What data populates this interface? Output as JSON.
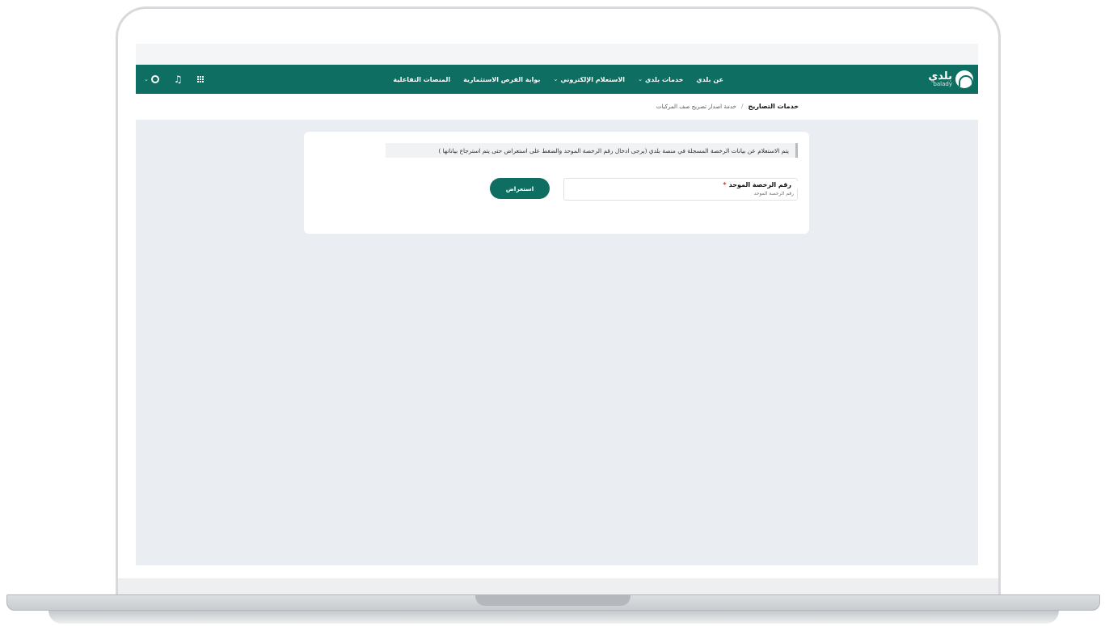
{
  "brand": {
    "name_ar": "بلدي",
    "name_en": "balady"
  },
  "nav": {
    "links": [
      {
        "label": "عن بلدي",
        "has_dropdown": false
      },
      {
        "label": "خدمات بلدي",
        "has_dropdown": true
      },
      {
        "label": "الاستعلام الإلكتروني",
        "has_dropdown": true
      },
      {
        "label": "بوابة الفرص الاستثمارية",
        "has_dropdown": false
      },
      {
        "label": "المنصات التفاعلية",
        "has_dropdown": false
      }
    ],
    "icons": [
      "apps-grid-icon",
      "bell-icon",
      "globe-icon"
    ]
  },
  "breadcrumb": {
    "main": "خدمات التصاريح",
    "separator": "/",
    "current": "خدمة اصدار تصريح صف المركبات"
  },
  "form": {
    "info_text": "يتم الاستعلام عن بيانات الرخصة المسجلة في منصة بلدي (يرجى ادخال رقم الرخصة الموحد والضغط على استعراض حتى يتم استرجاع بياناتها )",
    "license_label": "رقم الرخصة الموحد",
    "required_mark": "*",
    "license_placeholder": "رقم الرخصة الموحد",
    "submit_label": "استعراض"
  },
  "colors": {
    "primary": "#0f6e62",
    "page_bg": "#eaedf1",
    "required": "#d9322b"
  }
}
